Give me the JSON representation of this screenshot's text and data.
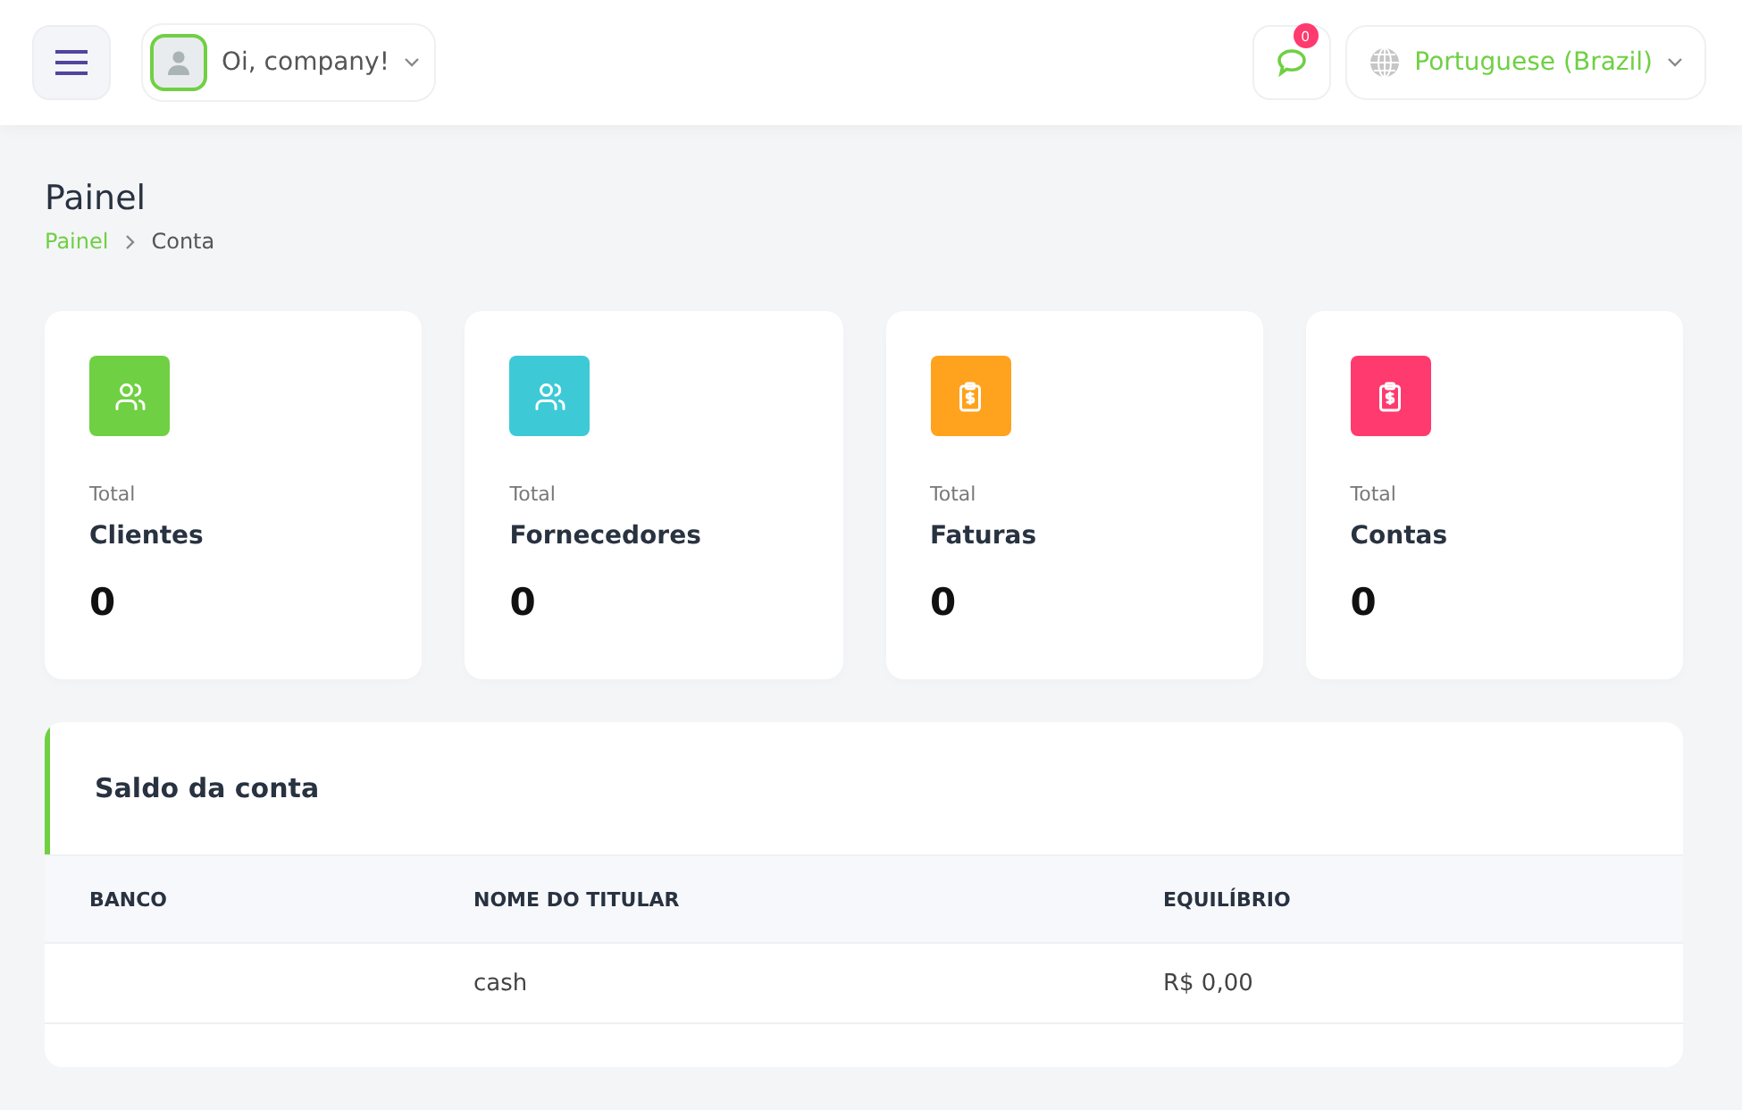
{
  "header": {
    "greeting": "Oi, company!",
    "notifications": {
      "count": "0"
    },
    "language": "Portuguese (Brazil)"
  },
  "page": {
    "title": "Painel",
    "breadcrumb": [
      {
        "label": "Painel",
        "selected": false
      },
      {
        "label": "Conta",
        "selected": true
      }
    ]
  },
  "stats": [
    {
      "kind": "users",
      "color": "#6fd043",
      "caption": "Total",
      "title": "Clientes",
      "value": "0"
    },
    {
      "kind": "users",
      "color": "#3ec9d6",
      "caption": "Total",
      "title": "Fornecedores",
      "value": "0"
    },
    {
      "kind": "clipboard",
      "color": "#ffa21d",
      "caption": "Total",
      "title": "Faturas",
      "value": "0"
    },
    {
      "kind": "clipboard",
      "color": "#ff3a6e",
      "caption": "Total",
      "title": "Contas",
      "value": "0"
    }
  ],
  "balance": {
    "title": "Saldo da conta",
    "columns": [
      "BANCO",
      "NOME DO TITULAR",
      "EQUILÍBRIO"
    ],
    "rows": [
      {
        "holder": "cash",
        "balance": "R$ 0,00"
      }
    ]
  }
}
